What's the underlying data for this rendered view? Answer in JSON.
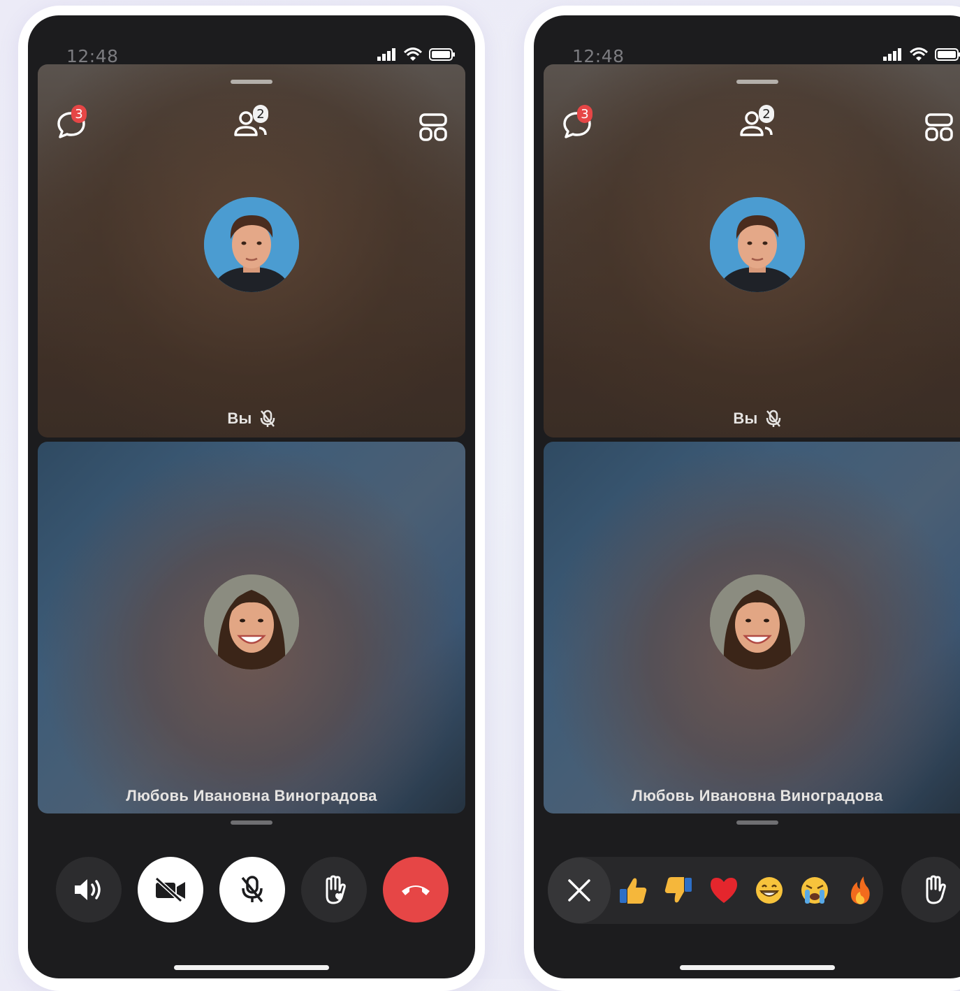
{
  "screens": [
    {
      "status_time": "12:48",
      "chat_badge": "3",
      "participants_badge": "2",
      "self_tile": {
        "label": "Вы"
      },
      "remote_tile": {
        "label": "Любовь Ивановна Виноградова"
      },
      "mode": "controls"
    },
    {
      "status_time": "12:48",
      "chat_badge": "3",
      "participants_badge": "2",
      "self_tile": {
        "label": "Вы"
      },
      "remote_tile": {
        "label": "Любовь Ивановна Виноградова"
      },
      "mode": "reactions"
    }
  ],
  "controls": [
    "speaker-icon",
    "camera-off-icon",
    "mic-off-icon",
    "raise-hand-heart-icon",
    "hang-up-icon"
  ],
  "reactions": [
    "thumbs-up",
    "thumbs-down",
    "heart",
    "grin",
    "crying",
    "fire"
  ],
  "colors": {
    "accent_red": "#e64646",
    "phone_bg": "#1c1c1e",
    "control_dark": "#2c2c2e"
  }
}
